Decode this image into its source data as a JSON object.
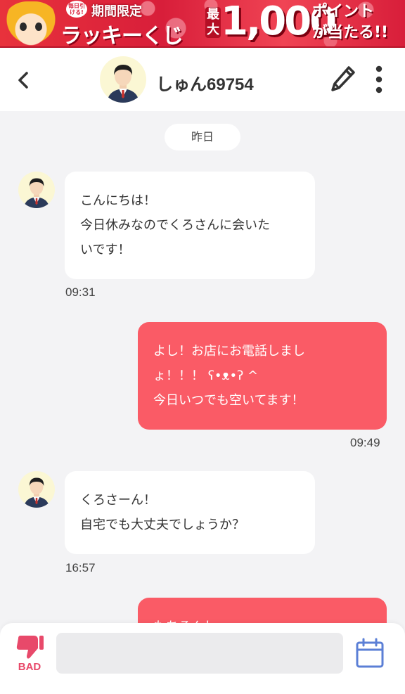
{
  "banner": {
    "badge": "毎日引ける!",
    "small_text": "期間限定",
    "big_text": "ラッキーくじ",
    "prize_label": "最大",
    "prize_amount": "1,000",
    "prize_sub_1": "ポイント",
    "prize_sub_2": "が当たる!!"
  },
  "header": {
    "name": "しゅん69754",
    "back_icon": "chevron-left-icon",
    "edit_icon": "pencil-icon",
    "more_icon": "more-vertical-icon"
  },
  "chat": {
    "date_label": "昨日",
    "messages": [
      {
        "direction": "incoming",
        "lines": [
          "こんにちは！",
          "今日休みなのでくろさんに会いた",
          "いです！"
        ],
        "time": "09:31"
      },
      {
        "direction": "outgoing",
        "lines": [
          "よし！お店にお電話しまし",
          "ょ！！！ ʕ•ᴥ•ʔ ^",
          "今日いつでも空いてます！"
        ],
        "time": "09:49"
      },
      {
        "direction": "incoming",
        "lines": [
          "くろさーん！",
          "自宅でも大丈夫でしょうか？"
        ],
        "time": "16:57"
      },
      {
        "direction": "outgoing",
        "lines": [
          "もちろんし"
        ],
        "time": ""
      }
    ]
  },
  "footer": {
    "bad_label": "BAD",
    "bad_icon": "thumbs-down-icon",
    "input_placeholder": "",
    "calendar_icon": "calendar-icon"
  },
  "colors": {
    "outgoing_bubble": "#fa5b66",
    "incoming_bubble": "#ffffff",
    "background": "#f3f3f5",
    "bad_accent": "#e8496a",
    "calendar_accent": "#5b7fd6"
  }
}
